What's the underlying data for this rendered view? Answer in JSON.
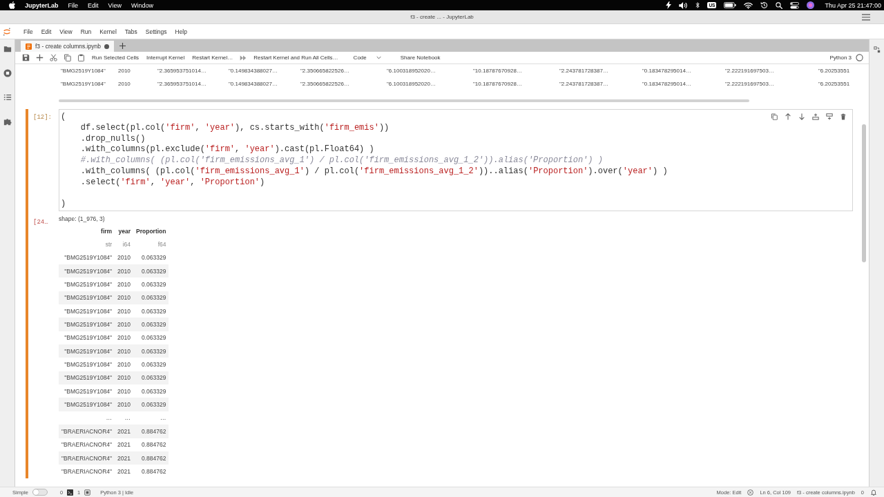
{
  "mac_menu_bar": {
    "app_name": "JupyterLab",
    "menus": [
      "File",
      "Edit",
      "View",
      "Window"
    ],
    "input_source": "US",
    "clock": "Thu Apr 25 21:47:00"
  },
  "window": {
    "title": "f3 - create ... - JupyterLab"
  },
  "menu_bar": {
    "items": [
      "File",
      "Edit",
      "View",
      "Run",
      "Kernel",
      "Tabs",
      "Settings",
      "Help"
    ]
  },
  "tabs": [
    {
      "label": "f3 - create columns.ipynb",
      "selected": true,
      "modified": true
    }
  ],
  "toolbar": {
    "buttons": [
      "Run Selected Cells",
      "Interrupt Kernel",
      "Restart Kernel…",
      "Restart Kernel and Run All Cells…"
    ],
    "cell_type": "Code",
    "share": "Share Notebook",
    "kernel_name": "Python 3",
    "kernel_busy": false
  },
  "previous_output": {
    "rows": [
      [
        "\"BMG2519Y1084\"",
        "2010",
        "\"2.365953751014…",
        "\"0.149834388027…",
        "\"2.350665822526…",
        "\"6.100318952020…",
        "\"10.18787670928…",
        "\"2.243781728387…",
        "\"0.183478295014…",
        "\"2.222191697503…",
        "\"6.20253551"
      ],
      [
        "\"BMG2519Y1084\"",
        "2010",
        "\"2.365953751014…",
        "\"0.149834388027…",
        "\"2.350665822526…",
        "\"6.100318952020…",
        "\"10.18787670928…",
        "\"2.243781728387…",
        "\"0.183478295014…",
        "\"2.222191697503…",
        "\"6.20253551"
      ]
    ]
  },
  "cells": [
    {
      "prompt": "[12]:",
      "selected": true,
      "lines": [
        {
          "indent": false,
          "blank_before": false,
          "tokens": [
            {
              "kind": "plain",
              "text": "("
            }
          ]
        },
        {
          "indent": true,
          "blank_before": false,
          "tokens": [
            {
              "kind": "plain",
              "text": "df.select(pl.col("
            },
            {
              "kind": "string",
              "text": "'firm'"
            },
            {
              "kind": "plain",
              "text": ", "
            },
            {
              "kind": "string",
              "text": "'year'"
            },
            {
              "kind": "plain",
              "text": "), cs.starts_with("
            },
            {
              "kind": "string",
              "text": "'firm_emis'"
            },
            {
              "kind": "plain",
              "text": "))"
            }
          ]
        },
        {
          "indent": true,
          "blank_before": false,
          "tokens": [
            {
              "kind": "plain",
              "text": ".drop_nulls()"
            }
          ]
        },
        {
          "indent": true,
          "blank_before": false,
          "tokens": [
            {
              "kind": "plain",
              "text": ".with_columns(pl.exclude("
            },
            {
              "kind": "string",
              "text": "'firm'"
            },
            {
              "kind": "plain",
              "text": ", "
            },
            {
              "kind": "string",
              "text": "'year'"
            },
            {
              "kind": "plain",
              "text": ").cast(pl.Float64) )"
            }
          ]
        },
        {
          "indent": true,
          "blank_before": false,
          "tokens": [
            {
              "kind": "comment",
              "text": "#.with_columns( (pl.col('firm_emissions_avg_1') / pl.col('firm_emissions_avg_1_2')).alias('Proportion') )"
            }
          ]
        },
        {
          "indent": true,
          "blank_before": false,
          "tokens": [
            {
              "kind": "plain",
              "text": ".with_columns( (pl.col("
            },
            {
              "kind": "string",
              "text": "'firm_emissions_avg_1'"
            },
            {
              "kind": "plain",
              "text": ") / pl.col("
            },
            {
              "kind": "string",
              "text": "'firm_emissions_avg_1_2'"
            },
            {
              "kind": "plain",
              "text": "))..alias("
            },
            {
              "kind": "string",
              "text": "'Proportion'"
            },
            {
              "kind": "plain",
              "text": ").over("
            },
            {
              "kind": "string",
              "text": "'year'"
            },
            {
              "kind": "plain",
              "text": ") )"
            }
          ]
        },
        {
          "indent": true,
          "blank_before": false,
          "tokens": [
            {
              "kind": "plain",
              "text": ".select("
            },
            {
              "kind": "string",
              "text": "'firm'"
            },
            {
              "kind": "plain",
              "text": ", "
            },
            {
              "kind": "string",
              "text": "'year'"
            },
            {
              "kind": "plain",
              "text": ", "
            },
            {
              "kind": "string",
              "text": "'Proportion'"
            },
            {
              "kind": "plain",
              "text": ")"
            }
          ]
        },
        {
          "indent": false,
          "blank_before": true,
          "tokens": [
            {
              "kind": "plain",
              "text": ")"
            }
          ]
        }
      ],
      "output": {
        "prompt": "[24…",
        "shape": "shape: (1_976, 3)",
        "columns": [
          {
            "name": "firm",
            "dtype": "str"
          },
          {
            "name": "year",
            "dtype": "i64"
          },
          {
            "name": "Proportion",
            "dtype": "f64"
          }
        ],
        "rows": [
          [
            "\"BMG2519Y1084\"",
            "2010",
            "0.063329"
          ],
          [
            "\"BMG2519Y1084\"",
            "2010",
            "0.063329"
          ],
          [
            "\"BMG2519Y1084\"",
            "2010",
            "0.063329"
          ],
          [
            "\"BMG2519Y1084\"",
            "2010",
            "0.063329"
          ],
          [
            "\"BMG2519Y1084\"",
            "2010",
            "0.063329"
          ],
          [
            "\"BMG2519Y1084\"",
            "2010",
            "0.063329"
          ],
          [
            "\"BMG2519Y1084\"",
            "2010",
            "0.063329"
          ],
          [
            "\"BMG2519Y1084\"",
            "2010",
            "0.063329"
          ],
          [
            "\"BMG2519Y1084\"",
            "2010",
            "0.063329"
          ],
          [
            "\"BMG2519Y1084\"",
            "2010",
            "0.063329"
          ],
          [
            "\"BMG2519Y1084\"",
            "2010",
            "0.063329"
          ],
          [
            "\"BMG2519Y1084\"",
            "2010",
            "0.063329"
          ],
          [
            "…",
            "…",
            "…"
          ],
          [
            "\"BRAERIACNOR4\"",
            "2021",
            "0.884762"
          ],
          [
            "\"BRAERIACNOR4\"",
            "2021",
            "0.884762"
          ],
          [
            "\"BRAERIACNOR4\"",
            "2021",
            "0.884762"
          ],
          [
            "\"BRAERIACNOR4\"",
            "2021",
            "0.884762"
          ]
        ]
      }
    }
  ],
  "status_bar": {
    "simple_mode": {
      "label": "Simple",
      "on": false
    },
    "terminals": "0",
    "kernels": "1",
    "kernel_status": "Python 3 | Idle",
    "mode": "Mode: Edit",
    "cursor_position": "Ln 6, Col 109",
    "file_name": "f3 - create columns.ipynb",
    "notifications": "0"
  }
}
